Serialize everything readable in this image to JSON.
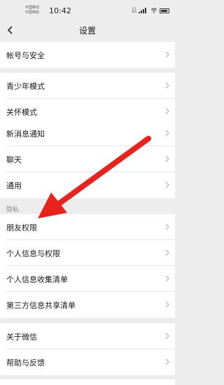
{
  "status_bar": {
    "carrier_1": "中国移动",
    "carrier_2": "中国电信",
    "time": "10:42",
    "net_speed_value": "2.1",
    "net_speed_unit": "K/s",
    "battery_icon": "battery-icon",
    "signal_icon": "signal-icon",
    "wifi_icon": "wifi-icon"
  },
  "nav": {
    "title": "设置",
    "back_icon": "back-chevron-icon"
  },
  "groups": [
    {
      "items": [
        {
          "label": "帐号与安全"
        }
      ]
    },
    {
      "items": [
        {
          "label": "青少年模式"
        },
        {
          "label": "关怀模式"
        }
      ]
    },
    {
      "items": [
        {
          "label": "新消息通知"
        },
        {
          "label": "聊天"
        },
        {
          "label": "通用"
        }
      ]
    },
    {
      "header": "隐私",
      "items": [
        {
          "label": "朋友权限"
        },
        {
          "label": "个人信息与权限"
        },
        {
          "label": "个人信息收集清单"
        },
        {
          "label": "第三方信息共享清单"
        }
      ]
    },
    {
      "items": [
        {
          "label": "关于微信"
        },
        {
          "label": "帮助与反馈"
        }
      ]
    }
  ],
  "annotation": {
    "arrow_color": "#e8231e",
    "points_to": "朋友权限"
  },
  "colors": {
    "background": "#ededed",
    "card": "#ffffff",
    "text": "#191919",
    "secondary_text": "#888888",
    "chevron": "#b2b2b2"
  }
}
